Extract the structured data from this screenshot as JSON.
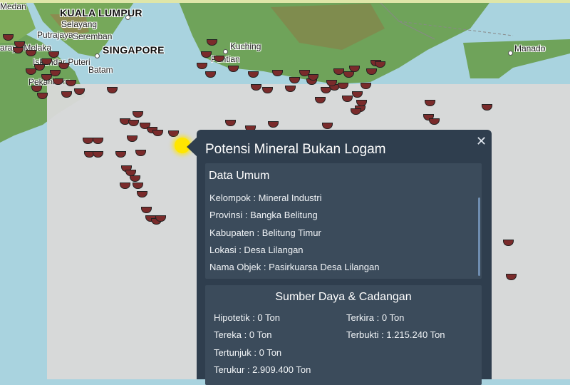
{
  "map": {
    "cities": [
      {
        "name": "Medan",
        "big": false
      },
      {
        "name": "KUALA LUMPUR",
        "big": true
      },
      {
        "name": "Selayang",
        "big": false
      },
      {
        "name": "Putrajaya",
        "big": false
      },
      {
        "name": "Seremban",
        "big": false
      },
      {
        "name": "araya Melaka",
        "big": false
      },
      {
        "name": "Iskandar Puteri",
        "big": false
      },
      {
        "name": "SINGAPORE",
        "big": true
      },
      {
        "name": "Batam",
        "big": false
      },
      {
        "name": "Kuching",
        "big": false
      },
      {
        "name": "Pontian",
        "big": false
      },
      {
        "name": "Manado",
        "big": false
      },
      {
        "name": "Pekanbaru",
        "big": false
      }
    ],
    "marker_icon": "mineral-bowl-icon",
    "colors": {
      "sea": "#a9d3df",
      "land": "#6fa35a",
      "marker": "#7a2b2b",
      "highlight": "#ffe600",
      "popup": "#2f3e4e"
    }
  },
  "popup": {
    "title": "Potensi Mineral Bukan Logam",
    "close_label": "✕",
    "general": {
      "heading": "Data Umum",
      "rows": [
        "Kelompok : Mineral Industri",
        "Provinsi : Bangka Belitung",
        "Kabupaten : Belitung Timur",
        "Lokasi : Desa Lilangan",
        "Nama Objek : Pasirkuarsa Desa Lilangan"
      ]
    },
    "resources": {
      "heading": "Sumber Daya & Cadangan",
      "left": [
        "Hipotetik : 0 Ton",
        "Tereka : 0 Ton",
        "Tertunjuk : 0 Ton",
        "Terukur : 2.909.400 Ton"
      ],
      "right": [
        "Terkira : 0 Ton",
        "Terbukti : 1.215.240 Ton"
      ]
    }
  }
}
